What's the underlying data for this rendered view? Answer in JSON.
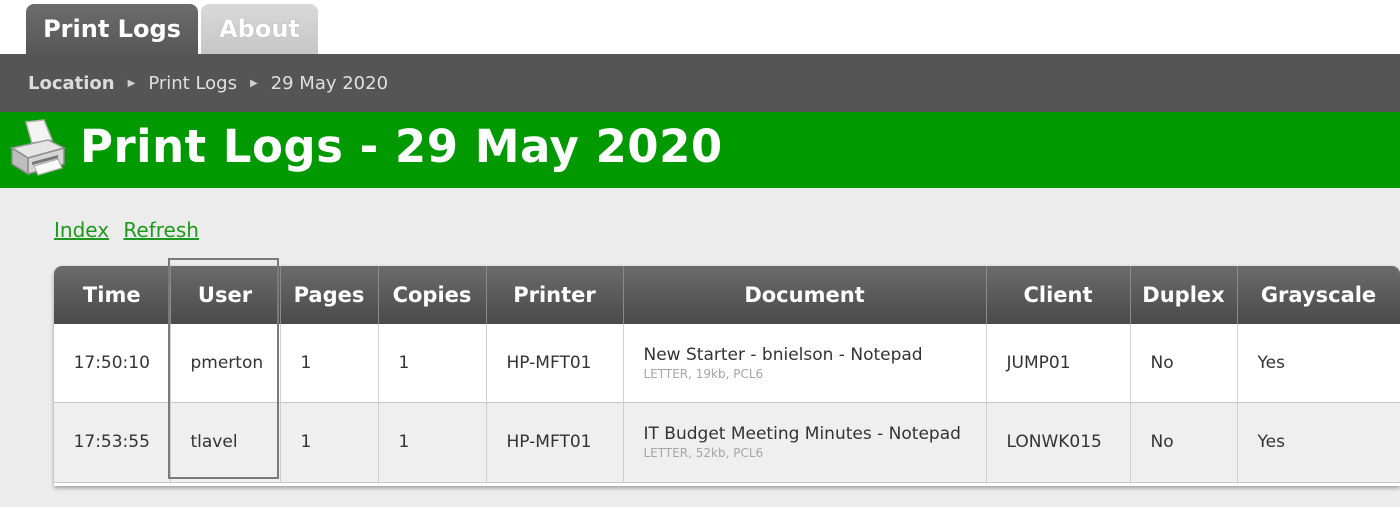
{
  "tabs": [
    {
      "label": "Print Logs",
      "active": true
    },
    {
      "label": "About",
      "active": false
    }
  ],
  "breadcrumb": {
    "items": [
      "Location",
      "Print Logs",
      "29 May 2020"
    ]
  },
  "header": {
    "icon": "printer-icon",
    "title": "Print Logs - 29 May 2020",
    "background_color": "#009900"
  },
  "links": {
    "index": "Index",
    "refresh": "Refresh"
  },
  "table": {
    "columns": [
      "Time",
      "User",
      "Pages",
      "Copies",
      "Printer",
      "Document",
      "Client",
      "Duplex",
      "Grayscale"
    ],
    "rows": [
      {
        "time": "17:50:10",
        "user": "pmerton",
        "pages": "1",
        "copies": "1",
        "printer": "HP-MFT01",
        "document": "New Starter - bnielson - Notepad",
        "document_meta": "LETTER, 19kb, PCL6",
        "client": "JUMP01",
        "duplex": "No",
        "grayscale": "Yes"
      },
      {
        "time": "17:53:55",
        "user": "tlavel",
        "pages": "1",
        "copies": "1",
        "printer": "HP-MFT01",
        "document": "IT Budget Meeting Minutes - Notepad",
        "document_meta": "LETTER, 52kb, PCL6",
        "client": "LONWK015",
        "duplex": "No",
        "grayscale": "Yes"
      }
    ]
  }
}
